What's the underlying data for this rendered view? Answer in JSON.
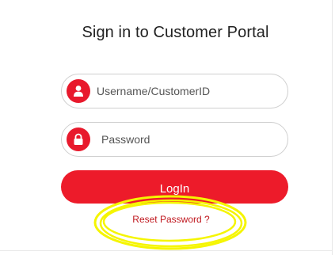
{
  "page": {
    "title": "Sign in to Customer Portal"
  },
  "form": {
    "username": {
      "placeholder": "Username/CustomerID",
      "value": "",
      "icon": "user-icon"
    },
    "password": {
      "placeholder": "Password",
      "value": "",
      "icon": "lock-icon"
    },
    "login_label": "LogIn",
    "reset_label": "Reset Password ?"
  },
  "colors": {
    "brand_red": "#ed1b2a",
    "link_red": "#c0181f",
    "highlight_yellow": "#f5f500"
  }
}
